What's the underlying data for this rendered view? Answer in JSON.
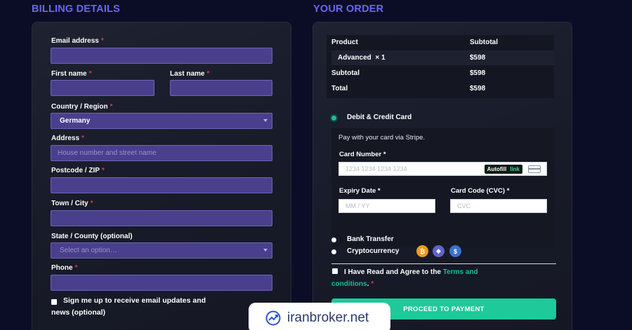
{
  "billing": {
    "title": "BILLING DETAILS",
    "email_label": "Email address",
    "first_name_label": "First name",
    "last_name_label": "Last name",
    "country_label": "Country / Region",
    "country_value": "Germany",
    "address_label": "Address",
    "address_placeholder": "House number and street name",
    "postcode_label": "Postcode / ZIP",
    "town_label": "Town / City",
    "state_label": "State / County (optional)",
    "state_placeholder": "Select an option…",
    "phone_label": "Phone",
    "required_mark": "*",
    "signup_line1": "Sign me up to receive email updates and",
    "signup_line2": "news (optional)"
  },
  "order": {
    "title": "YOUR ORDER",
    "col_product": "Product",
    "col_subtotal": "Subtotal",
    "item_name": "Advanced",
    "item_qty": "× 1",
    "item_price": "$598",
    "subtotal_label": "Subtotal",
    "subtotal_value": "$598",
    "total_label": "Total",
    "total_value": "$598"
  },
  "payment": {
    "card_option": "Debit & Credit Card",
    "stripe_note": "Pay with your card via Stripe.",
    "card_number_label": "Card Number *",
    "card_number_placeholder": "1234 1234 1234 1234",
    "autofill_label": "Autofill",
    "autofill_link": "link",
    "expiry_label": "Expiry Date *",
    "expiry_placeholder": "MM / YY",
    "cvc_label": "Card Code (CVC) *",
    "cvc_placeholder": "CVC",
    "bank_option": "Bank Transfer",
    "crypto_option": "Cryptocurrency",
    "terms_prefix": "I Have Read and Agree to the",
    "terms_link_1": "Terms and",
    "terms_link_2": "conditions",
    "terms_suffix": ".",
    "proceed_button": "PROCEED TO PAYMENT"
  },
  "watermark": {
    "text": "iranbroker.net"
  },
  "colors": {
    "accent": "#6a67ee",
    "success": "#1ec99a",
    "required": "#e0344c"
  }
}
